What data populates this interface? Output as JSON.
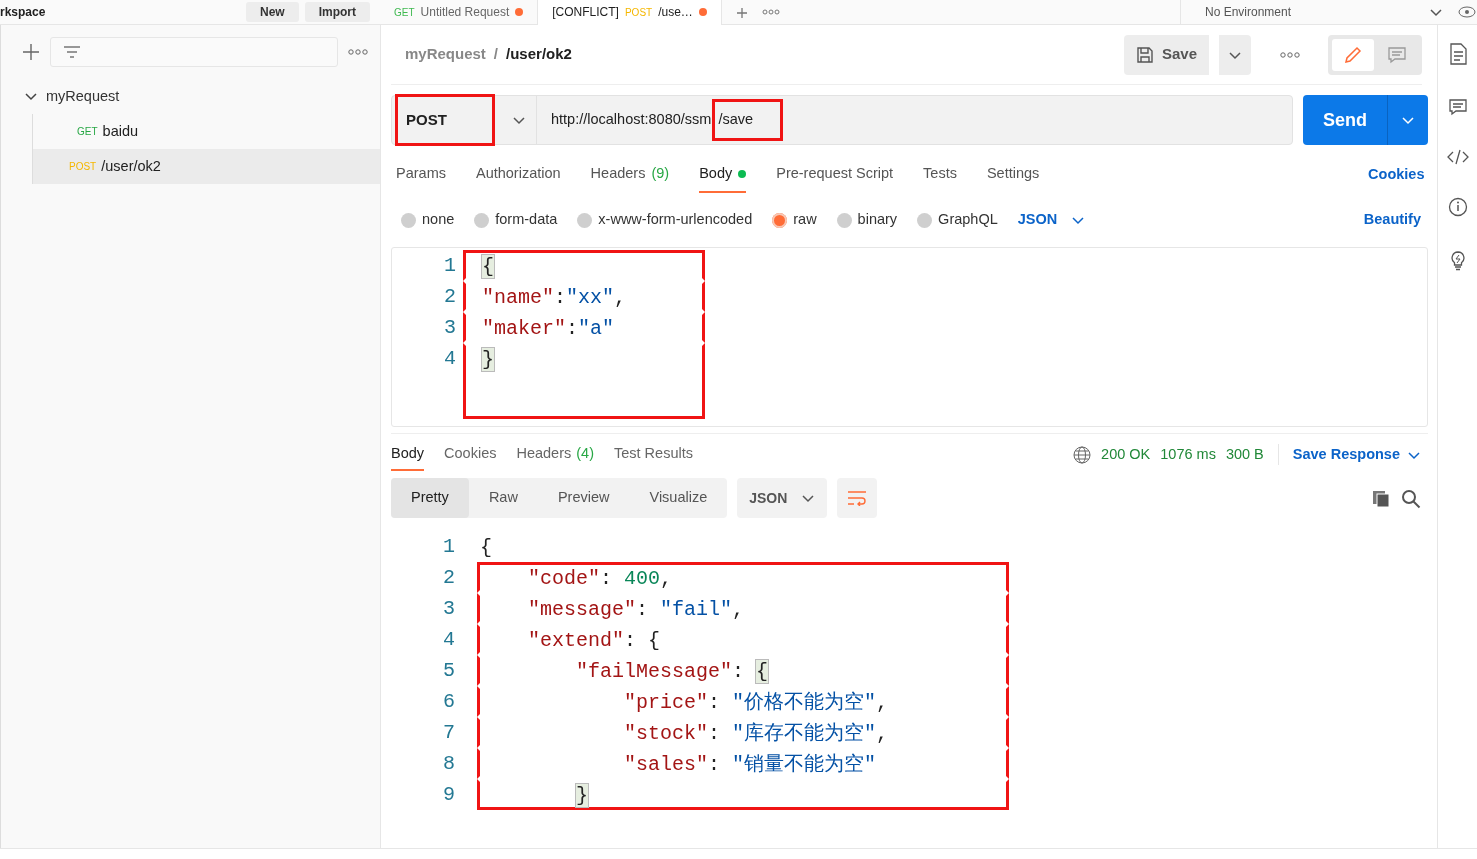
{
  "top_bar": {
    "workspace": "rkspace",
    "buttons": [
      "New",
      "Import"
    ],
    "tabs": [
      {
        "method": "GET",
        "color": "#3fb950",
        "label": "Untitled Request",
        "unsaved": true,
        "selected": false
      },
      {
        "prefix": "[CONFLICT]",
        "method": "POST",
        "color": "#f5b700",
        "label": "/use…",
        "unsaved": true,
        "selected": true
      }
    ],
    "environment": "No Environment"
  },
  "sidebar": {
    "items": [
      {
        "label": "myRequest",
        "expanded": true,
        "children": [
          {
            "method": "GET",
            "color": "#28a745",
            "label": "baidu",
            "selected": false
          },
          {
            "method": "POST",
            "color": "#f5b700",
            "label": "/user/ok2",
            "selected": true
          }
        ]
      }
    ]
  },
  "request": {
    "breadcrumb": [
      "myRequest",
      "/user/ok2"
    ],
    "breadcrumb_separator": "/",
    "save_label": "Save",
    "method": {
      "text": "POST",
      "highlighted": true
    },
    "url_parts": [
      {
        "text": "http://localhost:8080/ssm",
        "highlighted": false
      },
      {
        "text": "/save",
        "highlighted": true
      }
    ],
    "send_label": "Send",
    "tabs": [
      {
        "label": "Params",
        "dot": false,
        "selected": false
      },
      {
        "label": "Authorization",
        "dot": false,
        "selected": false
      },
      {
        "label": "Headers",
        "count": "(9)",
        "dot": false,
        "selected": false
      },
      {
        "label": "Body",
        "dot": true,
        "selected": true
      },
      {
        "label": "Pre-request Script",
        "dot": false,
        "selected": false
      },
      {
        "label": "Tests",
        "dot": false,
        "selected": false
      },
      {
        "label": "Settings",
        "dot": false,
        "selected": false
      }
    ],
    "cookies_link": "Cookies",
    "body_types": [
      {
        "label": "none",
        "selected": false
      },
      {
        "label": "form-data",
        "selected": false
      },
      {
        "label": "x-www-form-urlencoded",
        "selected": false
      },
      {
        "label": "raw",
        "selected": true
      },
      {
        "label": "binary",
        "selected": false
      },
      {
        "label": "GraphQL",
        "selected": false
      }
    ],
    "raw_format": "JSON",
    "beautify": "Beautify",
    "body_lines": [
      {
        "number": "1",
        "highlighted": true,
        "tokens": [
          {
            "kind": "bracket",
            "text": "{"
          }
        ]
      },
      {
        "number": "2",
        "highlighted": true,
        "tokens": [
          {
            "kind": "key",
            "text": "\"name\""
          },
          {
            "kind": "punct",
            "text": ":"
          },
          {
            "kind": "string",
            "text": "\"xx\""
          },
          {
            "kind": "punct",
            "text": ","
          }
        ]
      },
      {
        "number": "3",
        "highlighted": true,
        "tokens": [
          {
            "kind": "key",
            "text": "\"maker\""
          },
          {
            "kind": "punct",
            "text": ":"
          },
          {
            "kind": "string",
            "text": "\"a\""
          }
        ]
      },
      {
        "number": "4",
        "highlighted": true,
        "tokens": [
          {
            "kind": "bracket",
            "text": "}"
          }
        ]
      }
    ]
  },
  "response": {
    "tabs": [
      {
        "label": "Body",
        "selected": true
      },
      {
        "label": "Cookies",
        "selected": false
      },
      {
        "label": "Headers",
        "count": "(4)",
        "selected": false
      },
      {
        "label": "Test Results",
        "selected": false
      }
    ],
    "status": "200 OK",
    "time": "1076 ms",
    "size": "300 B",
    "save_response": "Save Response",
    "views": [
      {
        "label": "Pretty",
        "selected": true
      },
      {
        "label": "Raw",
        "selected": false
      },
      {
        "label": "Preview",
        "selected": false
      },
      {
        "label": "Visualize",
        "selected": false
      }
    ],
    "format": "JSON",
    "lines": [
      {
        "number": "1",
        "highlighted": false,
        "tokens": [
          {
            "kind": "punct",
            "text": "{"
          }
        ],
        "children": [
          {
            "number": "2",
            "highlighted": true,
            "tokens": [
              {
                "kind": "key",
                "text": "\"code\""
              },
              {
                "kind": "punct",
                "text": ": "
              },
              {
                "kind": "number",
                "text": "400"
              },
              {
                "kind": "punct",
                "text": ","
              }
            ]
          },
          {
            "number": "3",
            "highlighted": true,
            "tokens": [
              {
                "kind": "key",
                "text": "\"message\""
              },
              {
                "kind": "punct",
                "text": ": "
              },
              {
                "kind": "string",
                "text": "\"fail\""
              },
              {
                "kind": "punct",
                "text": ","
              }
            ]
          },
          {
            "number": "4",
            "highlighted": true,
            "tokens": [
              {
                "kind": "key",
                "text": "\"extend\""
              },
              {
                "kind": "punct",
                "text": ": {"
              }
            ],
            "children": [
              {
                "number": "5",
                "highlighted": true,
                "tokens": [
                  {
                    "kind": "key",
                    "text": "\"failMessage\""
                  },
                  {
                    "kind": "punct",
                    "text": ": "
                  },
                  {
                    "kind": "bracket",
                    "text": "{"
                  }
                ],
                "children": [
                  {
                    "number": "6",
                    "highlighted": true,
                    "tokens": [
                      {
                        "kind": "key",
                        "text": "\"price\""
                      },
                      {
                        "kind": "punct",
                        "text": ": "
                      },
                      {
                        "kind": "string",
                        "text": "\"价格不能为空\""
                      },
                      {
                        "kind": "punct",
                        "text": ","
                      }
                    ]
                  },
                  {
                    "number": "7",
                    "highlighted": true,
                    "tokens": [
                      {
                        "kind": "key",
                        "text": "\"stock\""
                      },
                      {
                        "kind": "punct",
                        "text": ": "
                      },
                      {
                        "kind": "string",
                        "text": "\"库存不能为空\""
                      },
                      {
                        "kind": "punct",
                        "text": ","
                      }
                    ]
                  },
                  {
                    "number": "8",
                    "highlighted": true,
                    "tokens": [
                      {
                        "kind": "key",
                        "text": "\"sales\""
                      },
                      {
                        "kind": "punct",
                        "text": ": "
                      },
                      {
                        "kind": "string",
                        "text": "\"销量不能为空\""
                      }
                    ]
                  }
                ]
              },
              {
                "number": "9",
                "highlighted": true,
                "tokens": [
                  {
                    "kind": "bracket",
                    "text": "}"
                  }
                ]
              }
            ]
          }
        ]
      }
    ]
  }
}
